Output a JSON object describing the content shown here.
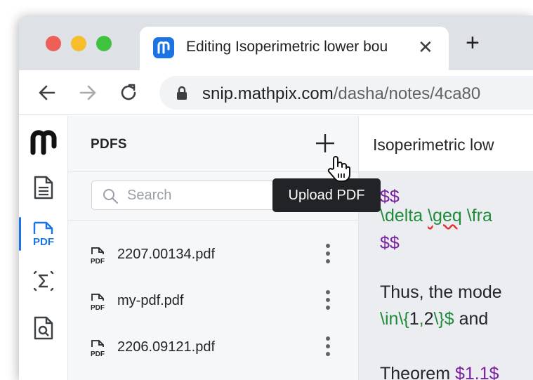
{
  "browser": {
    "tab_title": "Editing Isoperimetric lower bou",
    "favicon_icon": "mathpix-logo-icon",
    "tab_close": "✕",
    "new_tab": "+",
    "url_host": "snip.mathpix.com",
    "url_path": "/dasha/notes/4ca80"
  },
  "rail": {
    "logo": "mathpix-logo-icon",
    "items": [
      {
        "name": "notes-icon",
        "active": false
      },
      {
        "name": "pdf-icon",
        "label": "PDF",
        "active": true
      },
      {
        "name": "sigma-icon",
        "active": false
      },
      {
        "name": "file-search-icon",
        "active": false
      }
    ],
    "accent": "#1b74e4"
  },
  "panel": {
    "title": "PDFS",
    "upload_tooltip": "Upload PDF",
    "search_placeholder": "Search",
    "files": [
      {
        "name": "2207.00134.pdf"
      },
      {
        "name": "my-pdf.pdf"
      },
      {
        "name": "2206.09121.pdf"
      }
    ],
    "file_icon_label": "PDF"
  },
  "editor": {
    "title": "Isoperimetric low",
    "lines": [
      {
        "parts": [
          {
            "t": "$$",
            "c": "purple"
          }
        ]
      },
      {
        "parts": [
          {
            "t": "\\delta ",
            "c": "green"
          },
          {
            "t": "\\geq",
            "c": "green",
            "squiggle": true
          },
          {
            "t": " \\fra",
            "c": "green"
          }
        ]
      },
      {
        "parts": [
          {
            "t": "$$",
            "c": "purple"
          }
        ]
      },
      {
        "parts": [
          {
            "t": "Thus, the mode",
            "c": "dark"
          }
        ]
      },
      {
        "parts": [
          {
            "t": "\\in\\{",
            "c": "green"
          },
          {
            "t": "1",
            "c": "dark"
          },
          {
            "t": ",",
            "c": "green"
          },
          {
            "t": "2",
            "c": "dark"
          },
          {
            "t": "\\}$",
            "c": "green"
          },
          {
            "t": " and",
            "c": "dark"
          }
        ]
      },
      {
        "parts": [
          {
            "t": "Theorem ",
            "c": "dark"
          },
          {
            "t": "$1.1",
            "c": "purple"
          },
          {
            "t": "$",
            "c": "purple"
          }
        ]
      }
    ],
    "colors": {
      "math_delim": "#7b1fa2",
      "latex": "#1e8c3a",
      "spell_error": "#e03131"
    }
  }
}
